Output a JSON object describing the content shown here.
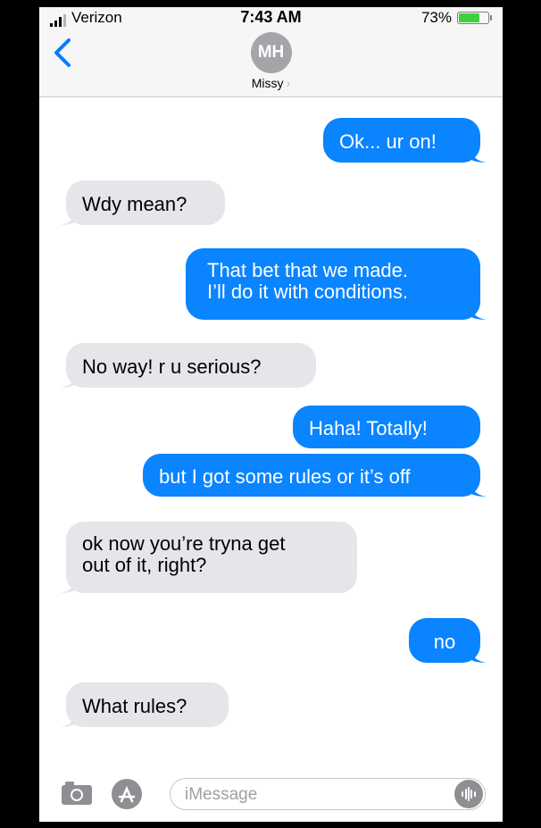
{
  "status_bar": {
    "carrier": "Verizon",
    "time": "7:43 AM",
    "battery_percent": "73%",
    "battery_level": 0.73
  },
  "header": {
    "avatar_initials": "MH",
    "contact_name": "Missy"
  },
  "messages": [
    {
      "side": "out",
      "text": "Ok... ur on!"
    },
    {
      "side": "in",
      "text": "Wdy mean?"
    },
    {
      "side": "out",
      "lines": [
        "That bet that we made.",
        "I’ll do it with conditions."
      ]
    },
    {
      "side": "in",
      "text": "No way! r u serious?"
    },
    {
      "side": "out",
      "text": "Haha! Totally!"
    },
    {
      "side": "out",
      "text": "but I got some rules or it’s off"
    },
    {
      "side": "in",
      "lines": [
        "ok now you’re tryna get",
        "out of it, right?"
      ]
    },
    {
      "side": "out",
      "text": "no"
    },
    {
      "side": "in",
      "text": "What rules?"
    }
  ],
  "composer": {
    "placeholder": "iMessage"
  },
  "colors": {
    "outgoing": "#0a84ff",
    "incoming": "#e5e5ea",
    "back_chevron": "#0a7aff",
    "battery": "#3dd13d"
  }
}
